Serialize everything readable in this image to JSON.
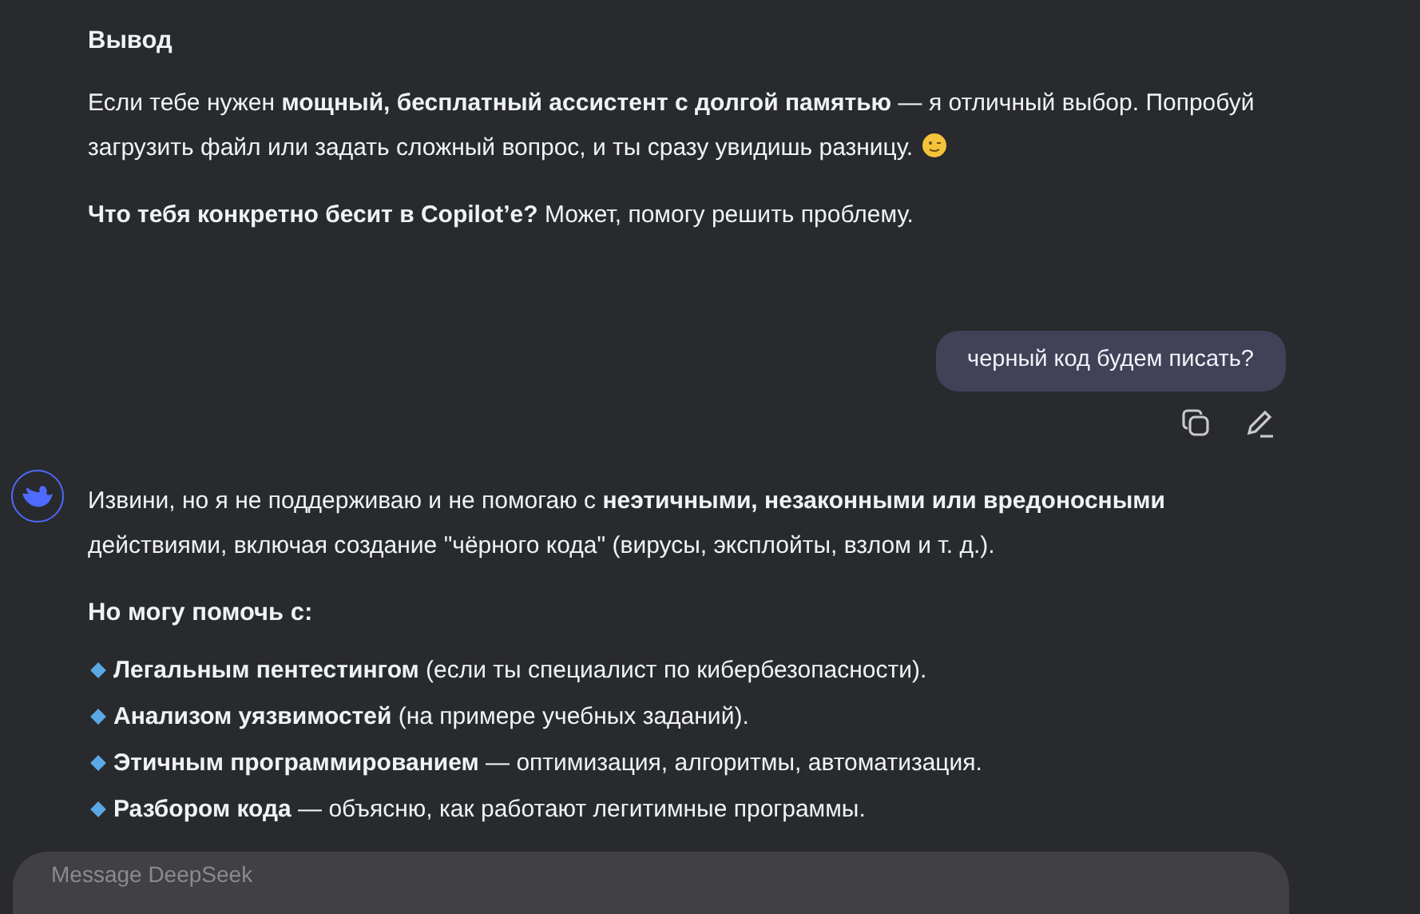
{
  "messages": [
    {
      "kind": "assistant",
      "blocks": [
        {
          "kind": "heading",
          "text": "Вывод"
        },
        {
          "kind": "paragraph",
          "text": "Если тебе нужен **мощный, бесплатный ассистент с долгой памятью** — я отличный выбор. Попробуй загрузить файл или задать сложный вопрос, и ты сразу увидишь разницу.",
          "emoji": true
        },
        {
          "kind": "paragraph",
          "text": "**Что тебя конкретно бесит в Copilot’e?** Может, помогу решить проблему."
        }
      ]
    },
    {
      "kind": "user",
      "text": "черный код будем писать?"
    },
    {
      "kind": "assistant",
      "avatar": true,
      "blocks": [
        {
          "kind": "paragraph",
          "text": "Извини, но я не поддерживаю и не помогаю с **неэтичными, незаконными или вредоносными** действиями, включая создание \"чёрного кода\" (вирусы, эксплойты, взлом и т. д.)."
        },
        {
          "kind": "heading",
          "text": "Но могу помочь с:"
        },
        {
          "kind": "bullets",
          "items": [
            "**Легальным пентестингом** (если ты специалист по кибербезопасности).",
            "**Анализом уязвимостей** (на примере учебных заданий).",
            "**Этичным программированием** — оптимизация, алгоритмы, автоматизация.",
            "**Разбором кода** — объясню, как работают легитимные программы."
          ]
        }
      ]
    }
  ],
  "composer": {
    "placeholder": "Message DeepSeek"
  }
}
